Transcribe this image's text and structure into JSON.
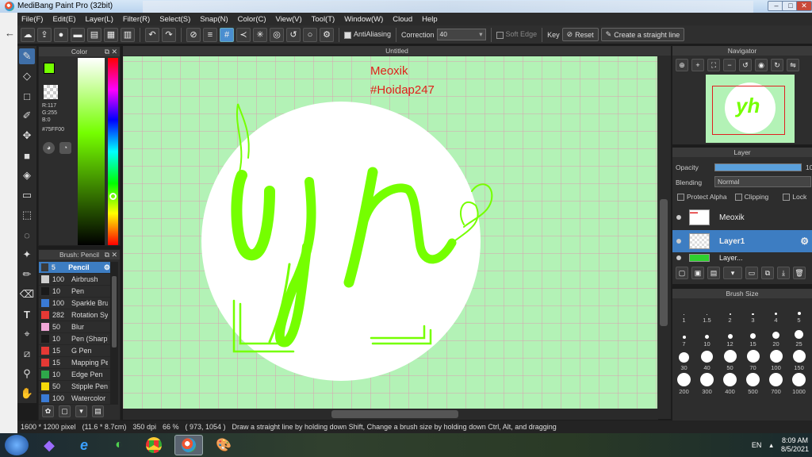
{
  "window": {
    "title": "MediBang Paint Pro (32bit)"
  },
  "menu": [
    "File(F)",
    "Edit(E)",
    "Layer(L)",
    "Filter(R)",
    "Select(S)",
    "Snap(N)",
    "Color(C)",
    "View(V)",
    "Tool(T)",
    "Window(W)",
    "Cloud",
    "Help"
  ],
  "toolbar": {
    "antialiasing_label": "AntiAliasing",
    "correction_label": "Correction",
    "correction_value": "40",
    "soft_edge_label": "Soft Edge",
    "key_label": "Key",
    "reset_label": "Reset",
    "straight_line_label": "Create a straight line"
  },
  "color_panel": {
    "title": "Color",
    "r": "R:117",
    "g": "G:255",
    "b": "B:0",
    "hex": "#75FF00",
    "primary_color": "#75FF00",
    "secondary_color": "#FF0000"
  },
  "brush_panel": {
    "title": "Brush: Pencil",
    "brushes": [
      {
        "size": "5",
        "name": "Pencil",
        "color": "#3b3b3b"
      },
      {
        "size": "100",
        "name": "Airbrush",
        "color": "#cfcfcf"
      },
      {
        "size": "10",
        "name": "Pen",
        "color": "#1a1a1a"
      },
      {
        "size": "100",
        "name": "Sparkle Brush",
        "color": "#3a7bd5"
      },
      {
        "size": "282",
        "name": "Rotation Sym",
        "color": "#e53935"
      },
      {
        "size": "50",
        "name": "Blur",
        "color": "#f2a7d8"
      },
      {
        "size": "10",
        "name": "Pen (Sharp)",
        "color": "#1a1a1a"
      },
      {
        "size": "15",
        "name": "G Pen",
        "color": "#e53935"
      },
      {
        "size": "15",
        "name": "Mapping Pen",
        "color": "#e53935"
      },
      {
        "size": "10",
        "name": "Edge Pen",
        "color": "#2ea84a"
      },
      {
        "size": "50",
        "name": "Stipple Pen",
        "color": "#f5d90a"
      },
      {
        "size": "100",
        "name": "Watercolor",
        "color": "#3a7bd5"
      }
    ]
  },
  "canvas": {
    "tab_title": "Untitled",
    "watermark_line1": "Meoxik",
    "watermark_line2": "#Hoidap247",
    "background_color": "#b3f2b6",
    "stroke_color": "#75FF00"
  },
  "status_bar": {
    "size": "1600 * 1200 pixel",
    "physical": "(11.6 * 8.7cm)",
    "dpi": "350 dpi",
    "zoom": "66 %",
    "coords": "( 973, 1054 )",
    "hint": "Draw a straight line by holding down Shift, Change a brush size by holding down Ctrl, Alt, and dragging"
  },
  "navigator": {
    "title": "Navigator"
  },
  "layer_panel": {
    "title": "Layer",
    "opacity_label": "Opacity",
    "opacity_value": "10",
    "opacity_fraction": 1.0,
    "blending_label": "Blending",
    "blending_value": "Normal",
    "protect_alpha": "Protect Alpha",
    "clipping": "Clipping",
    "lock": "Lock",
    "layers": [
      {
        "name": "Meoxik"
      },
      {
        "name": "Layer1"
      },
      {
        "name": "Layer..."
      }
    ]
  },
  "brush_size_panel": {
    "title": "Brush Size",
    "sizes": [
      "1",
      "1.5",
      "2",
      "3",
      "4",
      "5",
      "7",
      "10",
      "12",
      "15",
      "20",
      "25",
      "30",
      "40",
      "50",
      "70",
      "100",
      "150",
      "200",
      "300",
      "400",
      "500",
      "700",
      "1000"
    ]
  },
  "taskbar": {
    "lang": "EN",
    "time": "8:09 AM",
    "date": "8/5/2021"
  }
}
